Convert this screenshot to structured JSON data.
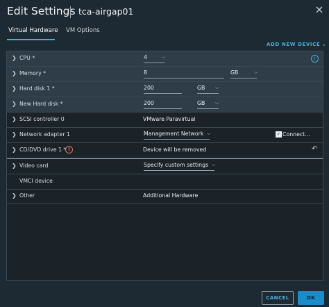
{
  "header": {
    "title": "Edit Settings",
    "vm_name": "tca-airgap01",
    "close_glyph": "×"
  },
  "tabs": [
    {
      "label": "Virtual Hardware",
      "active": true
    },
    {
      "label": "VM Options",
      "active": false
    }
  ],
  "add_device": {
    "label": "ADD NEW DEVICE",
    "chevron": "⌄"
  },
  "rows": {
    "cpu": {
      "label": "CPU *",
      "value": "4"
    },
    "memory": {
      "label": "Memory *",
      "value": "8",
      "unit": "GB"
    },
    "hard_disk_1": {
      "label": "Hard disk 1 *",
      "value": "200",
      "unit": "GB"
    },
    "new_hard_disk": {
      "label": "New Hard disk *",
      "value": "200",
      "unit": "GB"
    },
    "scsi": {
      "label": "SCSI controller 0",
      "value": "VMware Paravirtual"
    },
    "network": {
      "label": "Network adapter 1",
      "value": "Management Network",
      "connect_label": "Connect..."
    },
    "cddvd": {
      "label": "CD/DVD drive 1 *",
      "value": "Device will be removed"
    },
    "video": {
      "label": "Video card",
      "value": "Specify custom settings"
    },
    "vmci": {
      "label": "VMCI device"
    },
    "other": {
      "label": "Other",
      "value": "Additional Hardware"
    }
  },
  "footer": {
    "cancel_label": "CANCEL",
    "ok_label": "OK"
  },
  "colors": {
    "accent": "#49afd9",
    "ok_button": "#1a8ccb",
    "warning": "#e07860"
  }
}
